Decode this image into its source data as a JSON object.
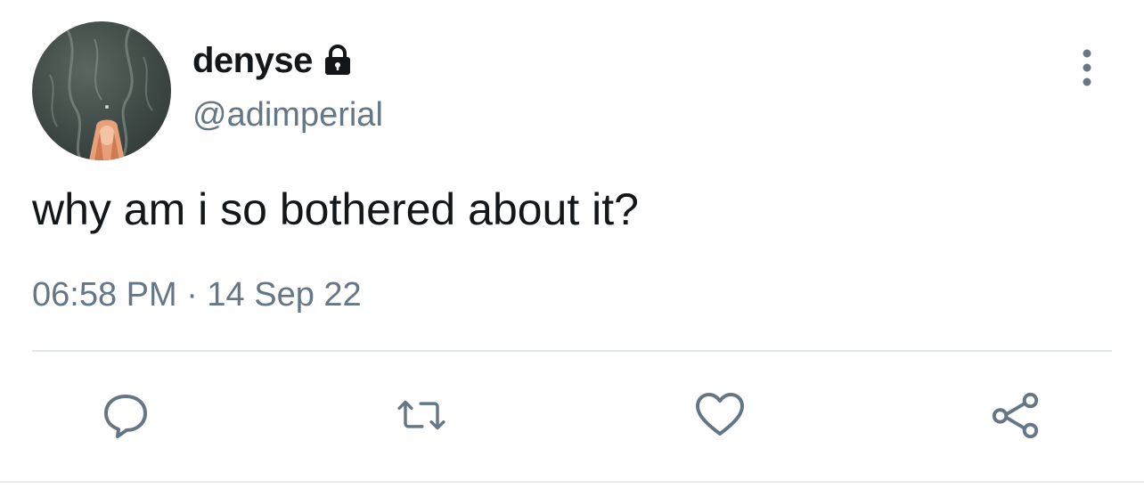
{
  "tweet": {
    "author": {
      "display_name": "denyse",
      "handle": "@adimperial",
      "protected_icon": "lock-icon",
      "avatar": "avatar-image"
    },
    "text": "why am i so bothered about it?",
    "timestamp": "06:58 PM · 14 Sep 22",
    "menu_icon": "more-vertical-icon"
  },
  "actions": [
    {
      "name": "reply",
      "icon": "reply-icon"
    },
    {
      "name": "retweet",
      "icon": "retweet-icon"
    },
    {
      "name": "like",
      "icon": "heart-icon"
    },
    {
      "name": "share",
      "icon": "share-icon"
    }
  ],
  "colors": {
    "text_primary": "#14171a",
    "text_secondary": "#657786",
    "divider": "#e1e8ed"
  }
}
